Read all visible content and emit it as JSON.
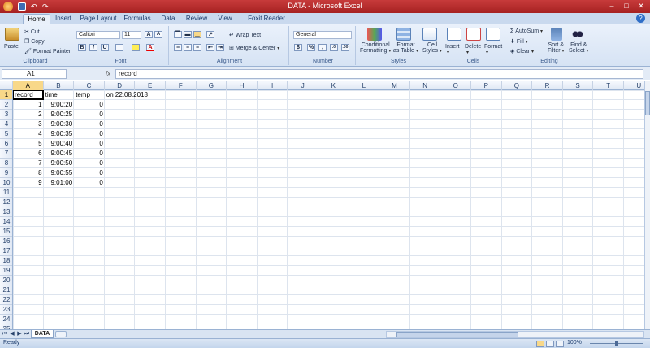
{
  "window": {
    "title": "DATA - Microsoft Excel",
    "controls": [
      "–",
      "□",
      "✕"
    ]
  },
  "tabs": [
    "Home",
    "Insert",
    "Page Layout",
    "Formulas",
    "Data",
    "Review",
    "View",
    "Foxit Reader PDF"
  ],
  "active_tab": "Home",
  "ribbon": {
    "clipboard": {
      "label": "Clipboard",
      "paste": "Paste",
      "cut": "Cut",
      "copy": "Copy",
      "format_painter": "Format Painter"
    },
    "font": {
      "label": "Font",
      "name": "Calibri",
      "size": "11",
      "bold": "B",
      "italic": "I",
      "underline": "U",
      "grow": "A",
      "shrink": "A",
      "font_color": "A"
    },
    "alignment": {
      "label": "Alignment",
      "wrap_text": "Wrap Text",
      "merge_center": "Merge & Center"
    },
    "number": {
      "label": "Number",
      "format": "General",
      "currency": "$",
      "percent": "%",
      "comma": ",",
      "inc_decimal": ".0",
      "dec_decimal": ".00"
    },
    "styles": {
      "label": "Styles",
      "conditional": "Conditional",
      "conditional2": "Formatting",
      "format_table": "Format",
      "format_table2": "as Table",
      "cell_styles": "Cell",
      "cell_styles2": "Styles"
    },
    "cells": {
      "label": "Cells",
      "insert": "Insert",
      "delete": "Delete",
      "format": "Format"
    },
    "editing": {
      "label": "Editing",
      "autosum": "AutoSum",
      "fill": "Fill",
      "clear": "Clear",
      "sort_filter": "Sort &",
      "sort_filter2": "Filter",
      "find_select": "Find &",
      "find_select2": "Select"
    }
  },
  "formula_bar": {
    "name_box": "A1",
    "fx": "fx",
    "value": "record"
  },
  "columns": [
    "A",
    "B",
    "C",
    "D",
    "E",
    "F",
    "G",
    "H",
    "I",
    "J",
    "K",
    "L",
    "M",
    "N",
    "O",
    "P",
    "Q",
    "R",
    "S",
    "T",
    "U"
  ],
  "selected_column": "A",
  "rows": [
    "1",
    "2",
    "3",
    "4",
    "5",
    "6",
    "7",
    "8",
    "9",
    "10",
    "11",
    "12",
    "13",
    "14",
    "15",
    "16",
    "17",
    "18",
    "19",
    "20",
    "21",
    "22",
    "23",
    "24",
    "25"
  ],
  "selected_row": "1",
  "sheet": {
    "headers": {
      "A": "record",
      "B": "time",
      "C": "temp",
      "D": "on 22.08.2018"
    },
    "data": [
      {
        "record": "1",
        "time": "9:00:20",
        "temp": "0"
      },
      {
        "record": "2",
        "time": "9:00:25",
        "temp": "0"
      },
      {
        "record": "3",
        "time": "9:00:30",
        "temp": "0"
      },
      {
        "record": "4",
        "time": "9:00:35",
        "temp": "0"
      },
      {
        "record": "5",
        "time": "9:00:40",
        "temp": "0"
      },
      {
        "record": "6",
        "time": "9:00:45",
        "temp": "0"
      },
      {
        "record": "7",
        "time": "9:00:50",
        "temp": "0"
      },
      {
        "record": "8",
        "time": "9:00:55",
        "temp": "0"
      },
      {
        "record": "9",
        "time": "9:01:00",
        "temp": "0"
      }
    ]
  },
  "sheet_tabs": [
    "DATA"
  ],
  "status": {
    "text": "Ready",
    "zoom": "100%"
  }
}
